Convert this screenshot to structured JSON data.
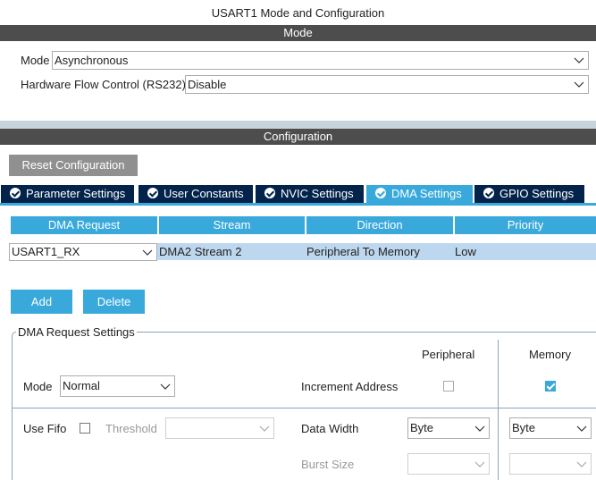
{
  "window": {
    "title": "USART1 Mode and Configuration"
  },
  "mode_section": {
    "header": "Mode",
    "mode_label": "Mode",
    "mode_value": "Asynchronous",
    "flow_label": "Hardware Flow Control (RS232)",
    "flow_value": "Disable"
  },
  "config_section": {
    "header": "Configuration",
    "reset_button": "Reset Configuration"
  },
  "tabs": [
    {
      "label": "Parameter Settings",
      "active": false
    },
    {
      "label": "User Constants",
      "active": false
    },
    {
      "label": "NVIC Settings",
      "active": false
    },
    {
      "label": "DMA Settings",
      "active": true
    },
    {
      "label": "GPIO Settings",
      "active": false
    }
  ],
  "dma_table": {
    "headers": [
      "DMA Request",
      "Stream",
      "Direction",
      "Priority"
    ],
    "rows": [
      {
        "request": "USART1_RX",
        "stream": "DMA2 Stream 2",
        "direction": "Peripheral To Memory",
        "priority": "Low"
      }
    ]
  },
  "actions": {
    "add": "Add",
    "delete": "Delete"
  },
  "request_settings": {
    "legend": "DMA Request Settings",
    "peripheral_header": "Peripheral",
    "memory_header": "Memory",
    "mode_label": "Mode",
    "mode_value": "Normal",
    "increment_label": "Increment Address",
    "peripheral_increment": false,
    "memory_increment": true,
    "fifo_label": "Use Fifo",
    "fifo_checked": false,
    "threshold_label": "Threshold",
    "threshold_value": "",
    "data_width_label": "Data Width",
    "peripheral_data_width": "Byte",
    "memory_data_width": "Byte",
    "burst_size_label": "Burst Size",
    "peripheral_burst": "",
    "memory_burst": ""
  },
  "colors": {
    "header_bar": "#4d4d4d",
    "tab_inactive": "#03234b",
    "accent_blue": "#39a9dc",
    "row_highlight": "#bdd7ee",
    "reset_button": "#909090"
  }
}
